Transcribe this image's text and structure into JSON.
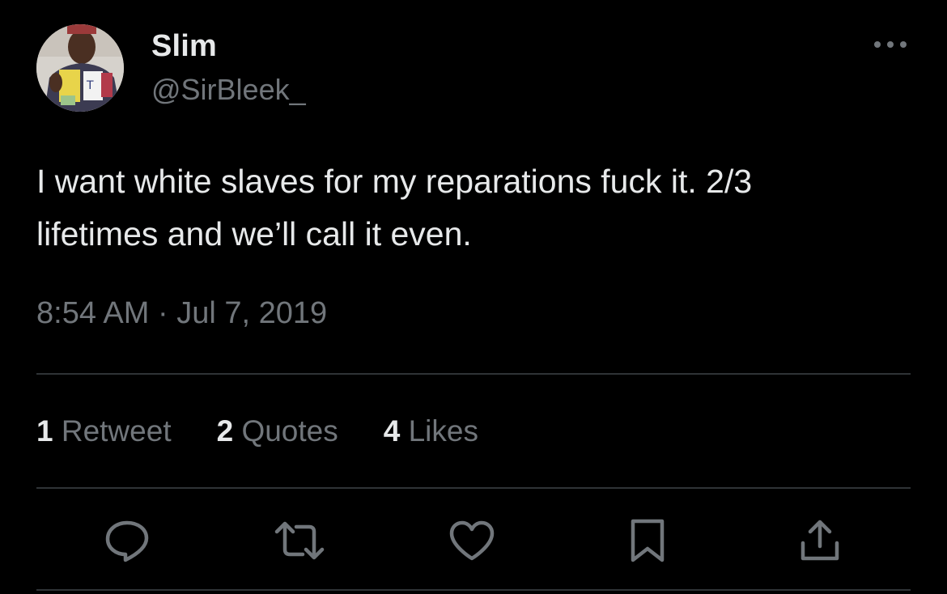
{
  "user": {
    "name": "Slim",
    "handle": "@SirBleek_"
  },
  "tweet": {
    "text_line1": "I want white slaves for my reparations fuck it. 2/3",
    "text_line2": "lifetimes and we’ll call it even.",
    "timestamp": "8:54 AM · Jul 7, 2019"
  },
  "stats": {
    "retweets_count": "1",
    "retweets_label": "Retweet",
    "quotes_count": "2",
    "quotes_label": "Quotes",
    "likes_count": "4",
    "likes_label": "Likes"
  },
  "icons": {
    "more": "more-horizontal-icon",
    "reply": "reply-icon",
    "retweet": "retweet-icon",
    "like": "heart-icon",
    "bookmark": "bookmark-icon",
    "share": "share-icon"
  },
  "colors": {
    "background": "#000000",
    "primary_text": "#e7e9ea",
    "secondary_text": "#71767b",
    "divider": "#2f3336"
  }
}
